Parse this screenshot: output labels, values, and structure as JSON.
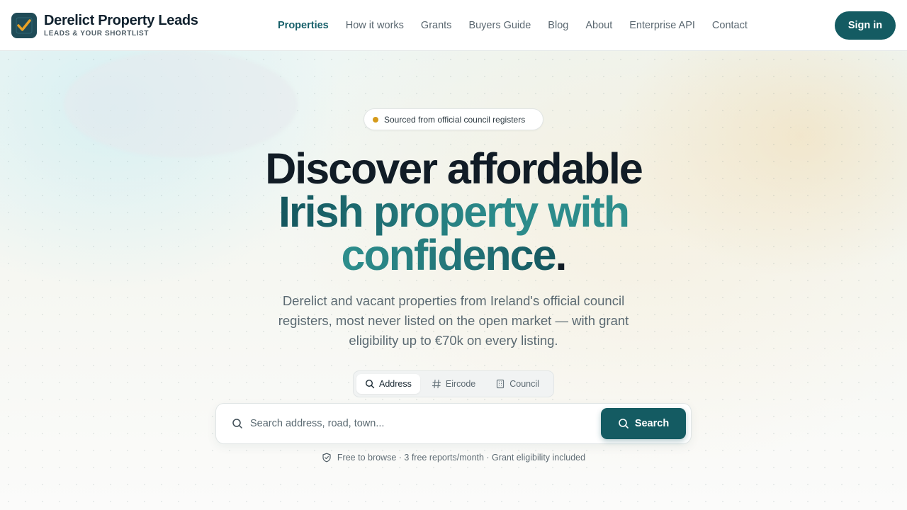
{
  "header": {
    "brand_name": "Derelict Property Leads",
    "brand_sub": "LEADS & YOUR SHORTLIST",
    "nav": [
      {
        "label": "Properties",
        "active": true
      },
      {
        "label": "How it works"
      },
      {
        "label": "Grants"
      },
      {
        "label": "Buyers Guide"
      },
      {
        "label": "Blog"
      },
      {
        "label": "About"
      },
      {
        "label": "Enterprise API"
      },
      {
        "label": "Contact"
      }
    ],
    "signin_label": "Sign in"
  },
  "hero": {
    "pill_text": "Sourced from official council registers",
    "title_line1": "Discover affordable",
    "title_line2": "Irish property with",
    "title_line3": "confidence",
    "title_period": ".",
    "lead": "Derelict and vacant properties from Ireland's official council registers, most never listed on the open market — with grant eligibility up to €70k on every listing.",
    "tabs": [
      {
        "label": "Address",
        "icon": "search-icon",
        "active": true
      },
      {
        "label": "Eircode",
        "icon": "hash-icon"
      },
      {
        "label": "Council",
        "icon": "building-icon"
      }
    ],
    "search_placeholder": "Search address, road, town...",
    "search_button": "Search",
    "note": "Free to browse · 3 free reports/month · Grant eligibility included"
  },
  "colors": {
    "primary": "#145b62",
    "accent_dot": "#d59a1a",
    "logo_check": "#e8a226"
  }
}
